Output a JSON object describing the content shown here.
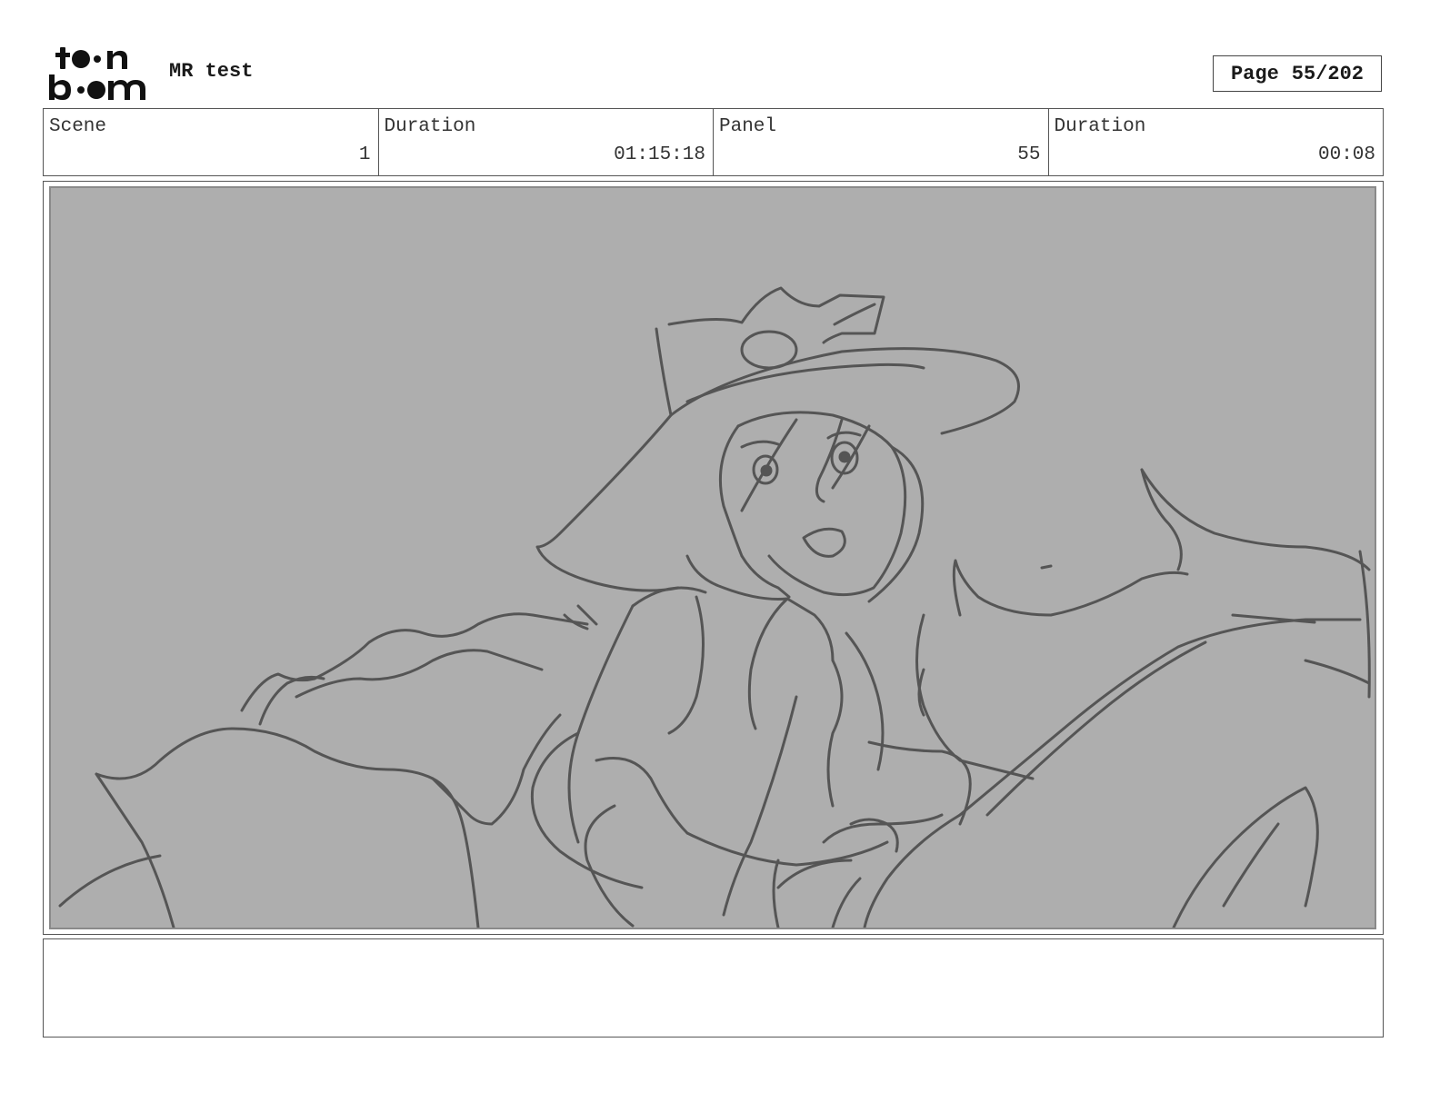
{
  "header": {
    "logo_text": "toon boom",
    "project_title": "MR test",
    "page_label": "Page",
    "page_number": "55/202"
  },
  "info": {
    "scene_label": "Scene",
    "scene_value": "1",
    "scene_duration_label": "Duration",
    "scene_duration_value": "01:15:18",
    "panel_label": "Panel",
    "panel_value": "55",
    "panel_duration_label": "Duration",
    "panel_duration_value": "00:08"
  },
  "panel": {
    "background_color": "#aeaeae",
    "sketch_color": "#555555"
  },
  "notes": {
    "text": ""
  }
}
